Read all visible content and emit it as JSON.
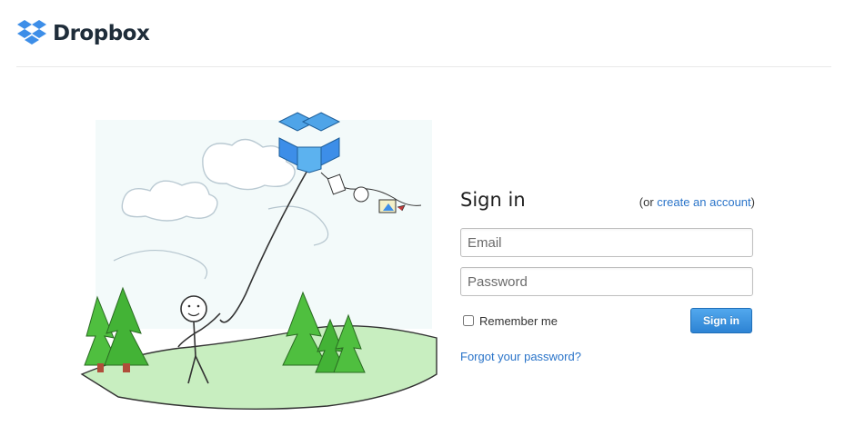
{
  "header": {
    "logo_icon": "dropbox-box-icon",
    "logo_text": "Dropbox"
  },
  "illustration": {
    "description_icon": "kite-flyer-illustration"
  },
  "signin": {
    "title": "Sign in",
    "create_prefix": "(or ",
    "create_link": "create an account",
    "create_suffix": ")",
    "email_placeholder": "Email",
    "email_value": "",
    "password_placeholder": "Password",
    "password_value": "",
    "remember_label": "Remember me",
    "remember_checked": false,
    "submit_label": "Sign in",
    "forgot_link": "Forgot your password?"
  },
  "colors": {
    "link": "#2a74c9",
    "button": "#3a8fdc",
    "dropbox_blue": "#3d8ee8"
  }
}
